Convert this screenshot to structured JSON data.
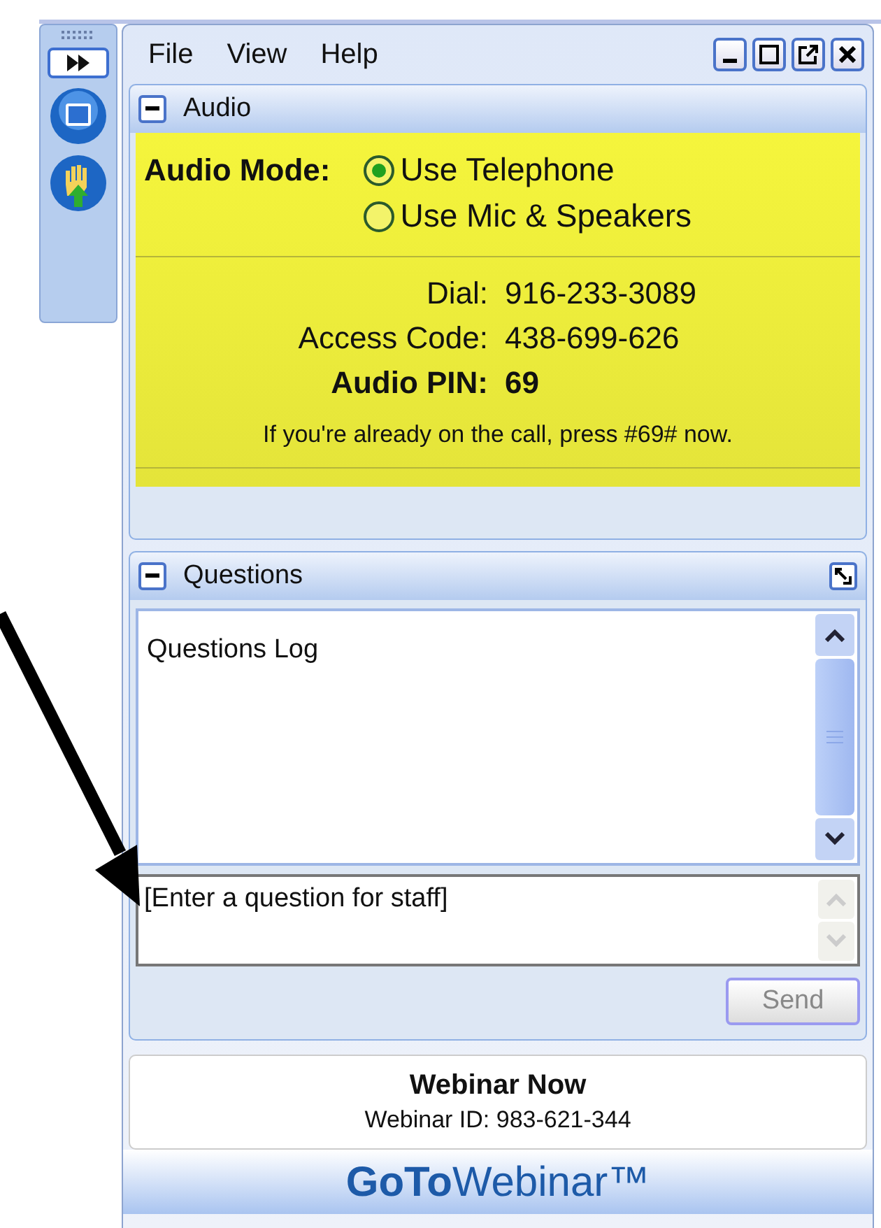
{
  "menu": [
    "File",
    "View",
    "Help"
  ],
  "audio": {
    "title": "Audio",
    "mode_label": "Audio Mode:",
    "options": [
      {
        "label": "Use Telephone",
        "selected": true
      },
      {
        "label": "Use Mic & Speakers",
        "selected": false
      }
    ],
    "lines": [
      {
        "kind": "plain",
        "label": "Dial:",
        "value": "916-233-3089"
      },
      {
        "kind": "plain",
        "label": "Access Code:",
        "value": "438-699-626"
      },
      {
        "kind": "strong",
        "label": "Audio PIN:",
        "value": "69"
      }
    ],
    "note": "If you're already on the call, press #69# now."
  },
  "questions": {
    "title": "Questions",
    "log_title": "Questions Log",
    "placeholder": "[Enter a question for staff]",
    "send": {
      "label": "Send",
      "disabled": true
    }
  },
  "footer": {
    "title": "Webinar Now",
    "webinar_id": "Webinar ID: 983-621-344",
    "logo": "**GoTo**Webinar™"
  }
}
